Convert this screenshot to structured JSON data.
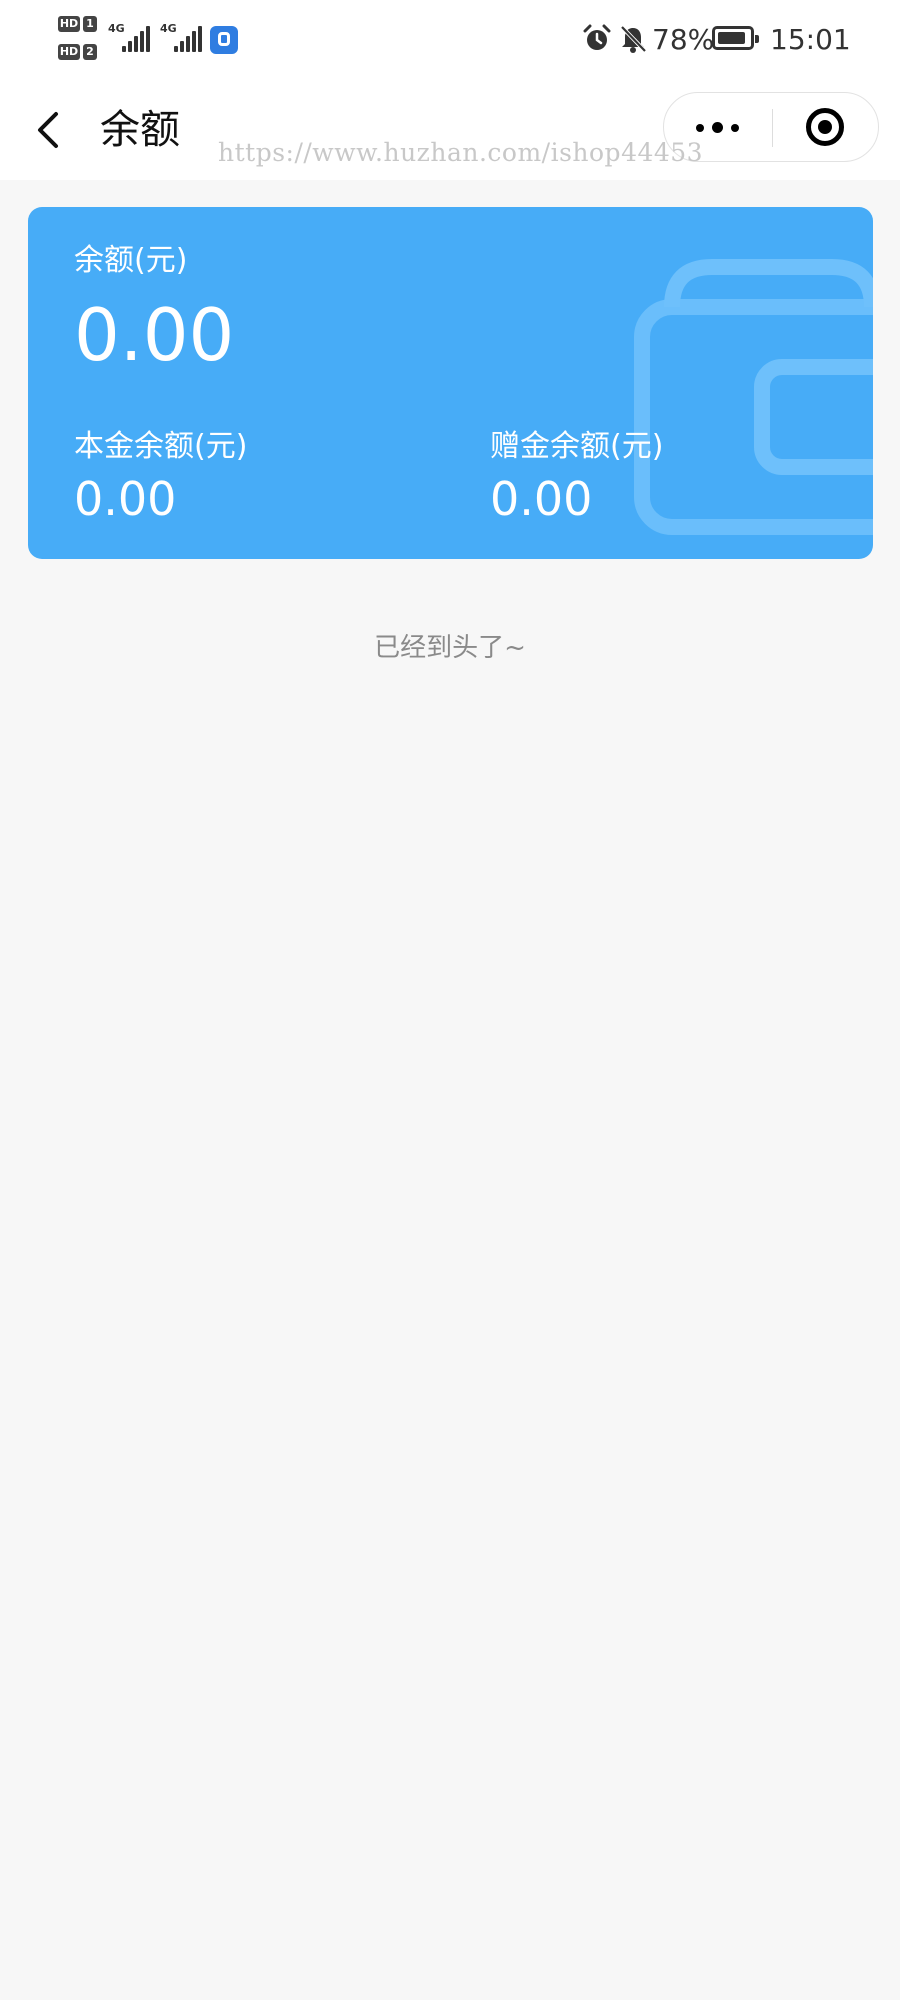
{
  "status_bar": {
    "sim1_label": "HD",
    "sim1_num": "1",
    "sim2_label": "HD",
    "sim2_num": "2",
    "network1": "4G",
    "network2": "4G",
    "battery_percent": "78%",
    "time": "15:01",
    "icons": [
      "alarm-icon",
      "bell-off-icon",
      "battery-icon",
      "app-notification-icon"
    ]
  },
  "nav": {
    "title": "余额",
    "back_icon": "chevron-left-icon",
    "more_icon": "more-dots-icon",
    "close_icon": "target-close-icon"
  },
  "watermark": "https://www.huzhan.com/ishop44453",
  "card": {
    "balance_label": "余额(元)",
    "balance_value": "0.00",
    "principal_label": "本金余额(元)",
    "principal_value": "0.00",
    "bonus_label": "赠金余额(元)",
    "bonus_value": "0.00",
    "background_color": "#47acf7",
    "decoration_icon": "wallet-icon"
  },
  "list_end_text": "已经到头了~"
}
